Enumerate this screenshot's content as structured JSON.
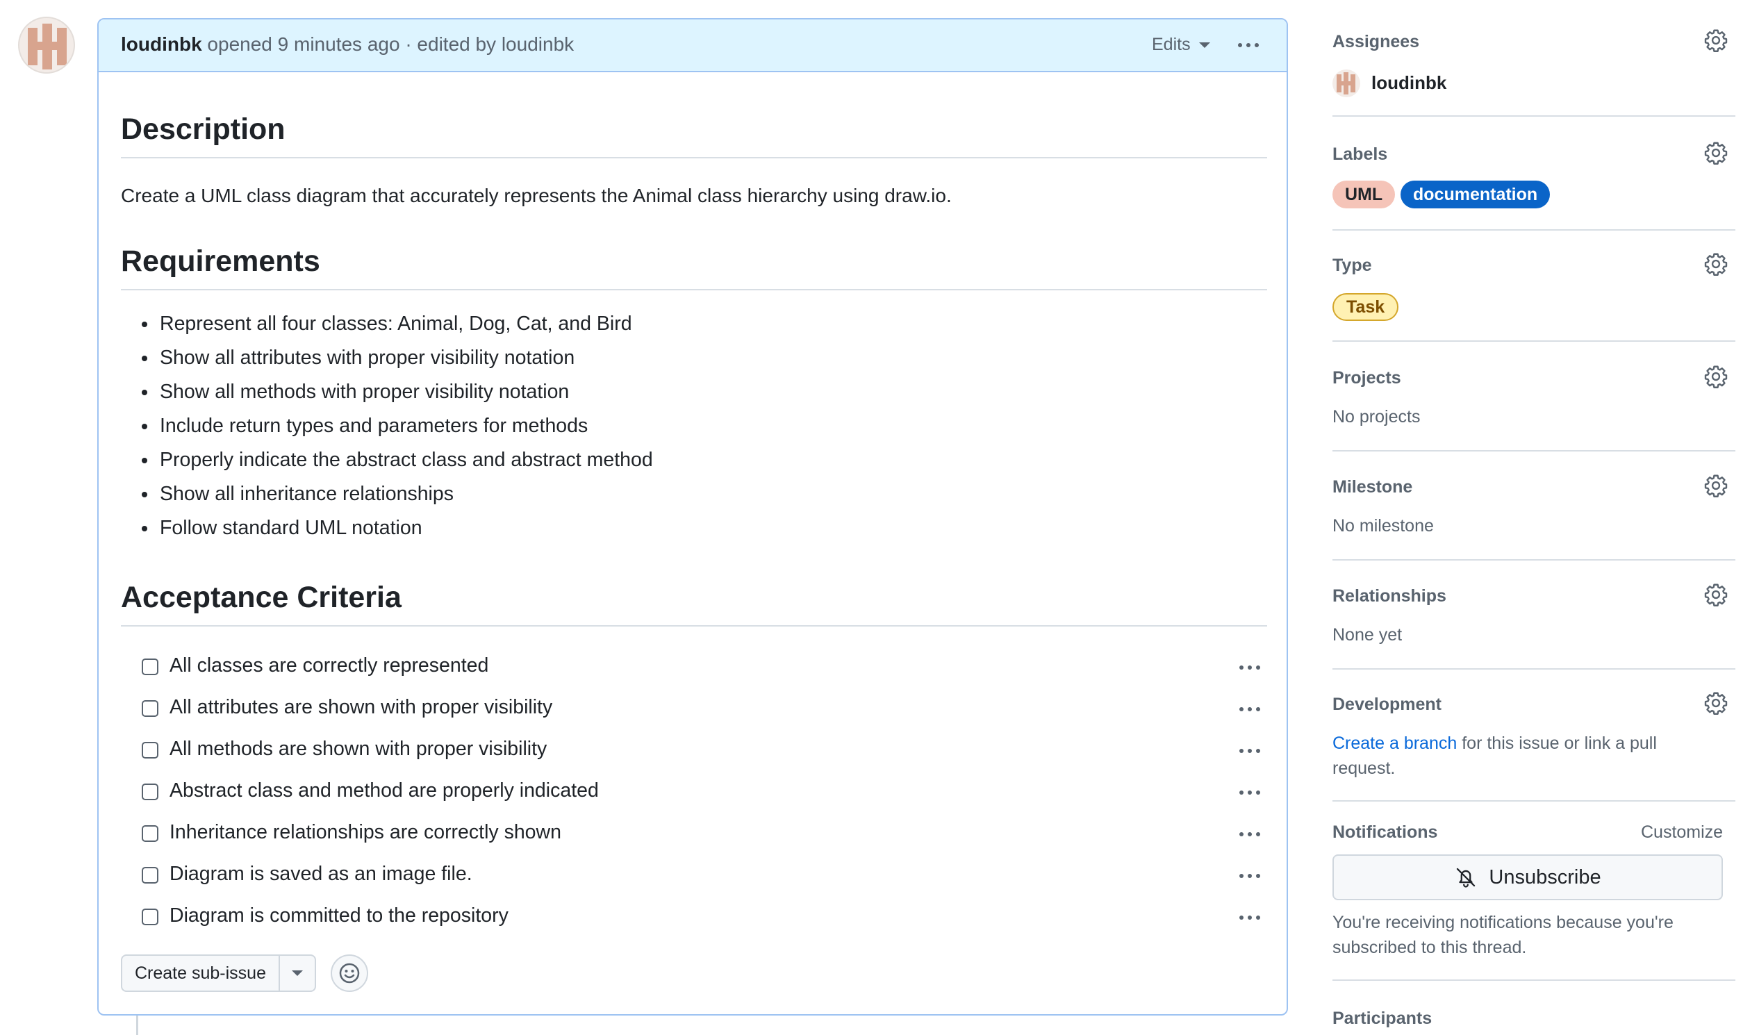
{
  "issue": {
    "header": {
      "author": "loudinbk",
      "meta": " opened 9 minutes ago · edited by loudinbk",
      "edits_label": "Edits"
    },
    "description": {
      "heading": "Description",
      "text": "Create a UML class diagram that accurately represents the Animal class hierarchy using draw.io."
    },
    "requirements": {
      "heading": "Requirements",
      "items": [
        "Represent all four classes: Animal, Dog, Cat, and Bird",
        "Show all attributes with proper visibility notation",
        "Show all methods with proper visibility notation",
        "Include return types and parameters for methods",
        "Properly indicate the abstract class and abstract method",
        "Show all inheritance relationships",
        "Follow standard UML notation"
      ]
    },
    "acceptance": {
      "heading": "Acceptance Criteria",
      "tasks": [
        {
          "label": "All classes are correctly represented",
          "checked": false
        },
        {
          "label": "All attributes are shown with proper visibility",
          "checked": false
        },
        {
          "label": "All methods are shown with proper visibility",
          "checked": false
        },
        {
          "label": "Abstract class and method are properly indicated",
          "checked": false
        },
        {
          "label": "Inheritance relationships are correctly shown",
          "checked": false
        },
        {
          "label": "Diagram is saved as an image file.",
          "checked": false
        },
        {
          "label": "Diagram is committed to the repository",
          "checked": false
        }
      ]
    },
    "footer": {
      "create_sub_issue": "Create sub-issue"
    }
  },
  "sidebar": {
    "assignees": {
      "title": "Assignees",
      "name": "loudinbk"
    },
    "labels": {
      "title": "Labels",
      "items": [
        {
          "name": "UML",
          "bg": "#f5c4b8",
          "fg": "#1f2328"
        },
        {
          "name": "documentation",
          "bg": "#0a64c8",
          "fg": "#ffffff"
        }
      ]
    },
    "type": {
      "title": "Type",
      "value": "Task",
      "bg": "#fff1b3",
      "fg": "#7d4e00",
      "border": "#d4a72c"
    },
    "projects": {
      "title": "Projects",
      "value": "No projects"
    },
    "milestone": {
      "title": "Milestone",
      "value": "No milestone"
    },
    "relationships": {
      "title": "Relationships",
      "value": "None yet"
    },
    "development": {
      "title": "Development",
      "link_text": "Create a branch",
      "rest_line1": " for this issue or link a pull",
      "line2": "request."
    },
    "notifications": {
      "title": "Notifications",
      "customize": "Customize",
      "button": "Unsubscribe",
      "line1": "You're receiving notifications because you're",
      "line2": "subscribed to this thread."
    },
    "participants": {
      "title": "Participants"
    }
  },
  "colors": {
    "accent_link": "#0969da",
    "header_bg": "#ddf4ff",
    "card_border": "#9ec3f2"
  }
}
